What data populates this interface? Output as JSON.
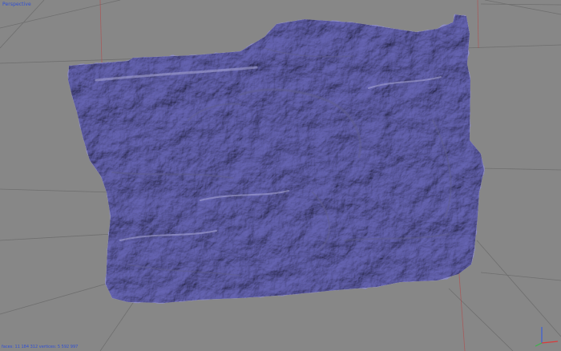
{
  "viewport": {
    "label": "Perspective",
    "label_color": "#2f4fd6",
    "background": "#878787",
    "grid_line_color": "#6e6e6e",
    "grid_axis_red": "#b24a4a",
    "grid_axis_green": "#4f9a4f"
  },
  "status": {
    "text": "faces: 11 184 312 vertices: 5 592 997",
    "color": "#2f4fd6"
  },
  "model": {
    "color": "#8d8cc2",
    "shade_light": "#a9a8d6",
    "shade_dark": "#5f5e8e"
  },
  "axis_gizmo": {
    "x_color": "#d83b3b",
    "y_color": "#3bb34a",
    "z_color": "#3b5fd8"
  }
}
